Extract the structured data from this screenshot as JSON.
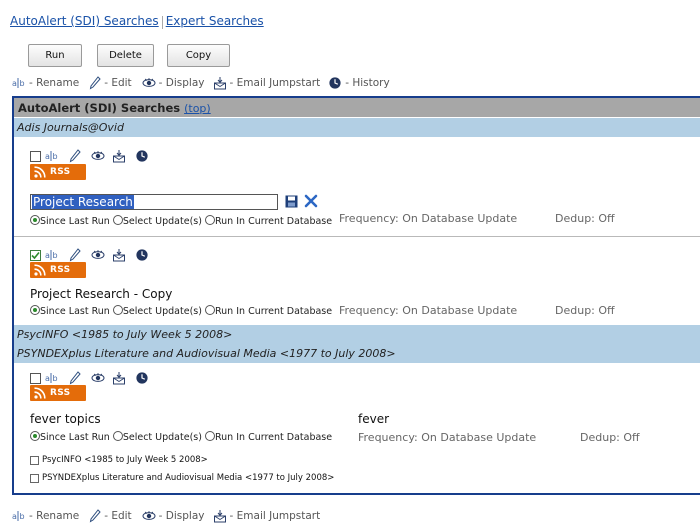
{
  "top_tabs": {
    "autoalert": "AutoAlert (SDI) Searches",
    "expert": "Expert Searches"
  },
  "toolbar": {
    "run": "Run",
    "delete": "Delete",
    "copy": "Copy"
  },
  "legend": {
    "rename": "- Rename",
    "edit": "- Edit",
    "display": "- Display",
    "email": "- Email Jumpstart",
    "history": "- History"
  },
  "section": {
    "title": "AutoAlert (SDI) Searches",
    "top_link": "(top)"
  },
  "rss_label": "RSS",
  "groups": [
    {
      "databases": [
        "Adis Journals@Ovid"
      ],
      "searches": [
        {
          "name": "Project Research",
          "editing": true,
          "checked": false,
          "options": [
            "Since Last Run",
            "Select Update(s)",
            "Run In Current Database"
          ],
          "selected_option": "Since Last Run",
          "frequency": "Frequency: On Database Update",
          "dedup": "Dedup: Off"
        },
        {
          "name": "Project Research - Copy",
          "editing": false,
          "checked": true,
          "options": [
            "Since Last Run",
            "Select Update(s)",
            "Run In Current Database"
          ],
          "selected_option": "Since Last Run",
          "frequency": "Frequency: On Database Update",
          "dedup": "Dedup: Off"
        }
      ]
    },
    {
      "databases": [
        "PsycINFO <1985 to July Week 5 2008>",
        "PSYNDEXplus Literature and Audiovisual Media <1977 to July 2008>"
      ],
      "searches": [
        {
          "name": "fever topics",
          "query": "fever",
          "checked": false,
          "options": [
            "Since Last Run",
            "Select Update(s)",
            "Run In Current Database"
          ],
          "selected_option": "Since Last Run",
          "frequency": "Frequency: On Database Update",
          "dedup": "Dedup: Off",
          "db_checklist": [
            "PsycINFO <1985 to July Week 5 2008>",
            "PSYNDEXplus Literature and Audiovisual Media <1977 to July 2008>"
          ]
        }
      ]
    }
  ],
  "colors": {
    "link": "#1a52a8",
    "header_gray": "#a7a7a7",
    "db_bar": "#b2cfe4",
    "frame": "#173d8c",
    "rss": "#e46c0a",
    "selection": "#3060c0"
  },
  "icons": {
    "rename": "rename-icon",
    "edit": "pencil-icon",
    "display": "eye-icon",
    "email": "email-jumpstart-icon",
    "history": "history-clock-icon",
    "save": "save-disk-icon",
    "cancel": "close-icon"
  }
}
